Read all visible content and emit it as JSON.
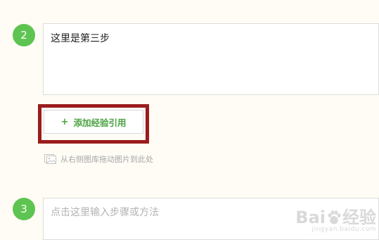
{
  "steps": [
    {
      "number": "2",
      "text": "这里是第三步"
    },
    {
      "number": "3",
      "placeholder": "点击这里输入步骤或方法"
    }
  ],
  "add_reference": {
    "plus": "+",
    "label": "添加经验引用"
  },
  "drag_hint": {
    "icon": "image-icon",
    "text": "从右侧图库拖动图片到此处"
  },
  "watermark": {
    "brand_prefix": "Bai",
    "brand_suffix": "经验",
    "domain": "jingyan.baidu.com",
    "icon": "paw-icon"
  },
  "colors": {
    "background": "#fefcf5",
    "step_badge": "#5ec451",
    "accent_green": "#4aa33f",
    "highlight_frame": "#9b1c1c"
  }
}
